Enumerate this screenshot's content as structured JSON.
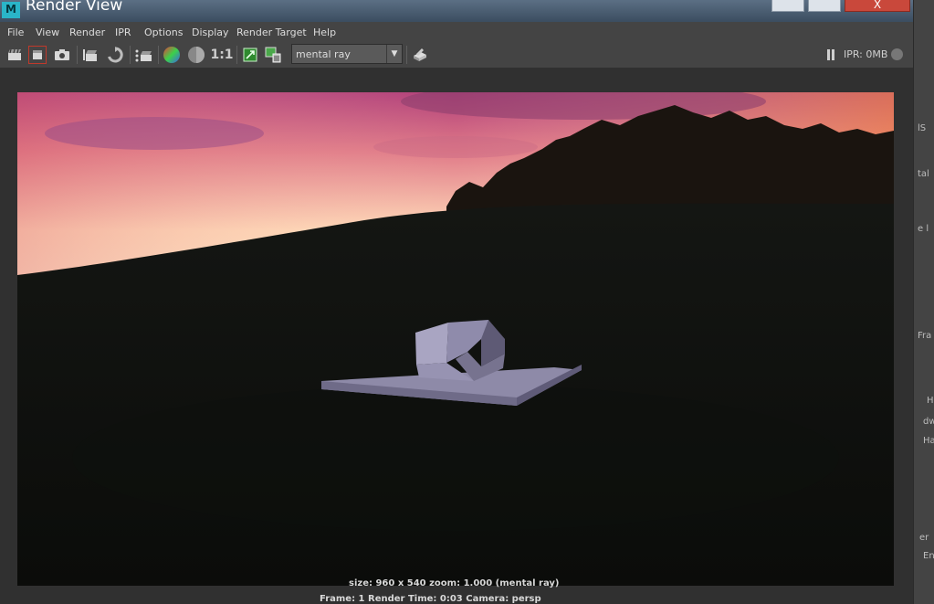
{
  "window": {
    "title": "Render View",
    "app_logo": "M",
    "close_glyph": "X"
  },
  "menubar": {
    "items": [
      "File",
      "View",
      "Render",
      "IPR",
      "Options",
      "Display",
      "Render Target",
      "Help"
    ]
  },
  "toolbar": {
    "icons": [
      "render-clapboard-icon",
      "render-region-icon",
      "snapshot-camera-icon",
      "ipr-render-icon",
      "refresh-icon",
      "render-sequence-icon",
      "rgb-channels-icon",
      "alpha-channel-icon",
      "real-size-icon",
      "keep-image-icon",
      "remove-image-icon",
      "render-settings-icon"
    ],
    "real_size_label": "1:1",
    "renderer": "mental ray",
    "ipr_status": "IPR: 0MB"
  },
  "status": {
    "line1": "size: 960 x 540  zoom: 1.000        (mental ray)",
    "line2": "Frame: 1       Render Time: 0:03        Camera: persp"
  },
  "background_app": {
    "fragments": [
      "lS",
      "tal",
      "e l",
      "Fra",
      "H",
      "dw",
      "Ha",
      "er",
      "En"
    ]
  }
}
